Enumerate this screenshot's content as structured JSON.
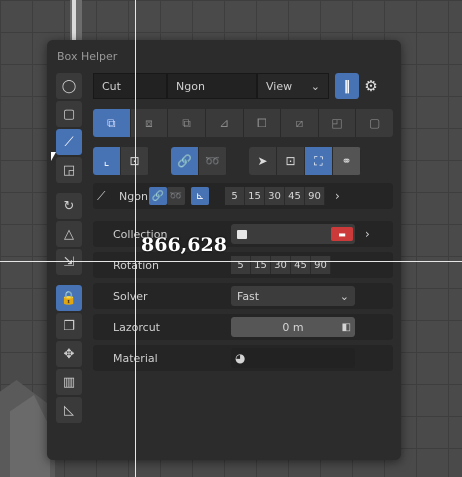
{
  "panel": {
    "title": "Box Helper"
  },
  "top_row": {
    "mode_value": "Cut",
    "shape_value": "Ngon",
    "view_value": "View",
    "pause_label": "‖",
    "gear_label": "⚙"
  },
  "ngon_row": {
    "label": "Ngon",
    "snap_values": [
      "5",
      "15",
      "30",
      "45",
      "90"
    ]
  },
  "properties": {
    "collection_label": "Collection",
    "rotation_label": "Rotation",
    "rotation_values": [
      "5",
      "15",
      "30",
      "45",
      "90"
    ],
    "solver_label": "Solver",
    "solver_value": "Fast",
    "lazorcut_label": "Lazorcut",
    "lazorcut_value": "0 m",
    "material_label": "Material"
  },
  "overlay": {
    "coords": "866,628"
  },
  "colors": {
    "accent": "#4772b3",
    "panel": "#2c2c2c",
    "red": "#cc3a3a"
  }
}
